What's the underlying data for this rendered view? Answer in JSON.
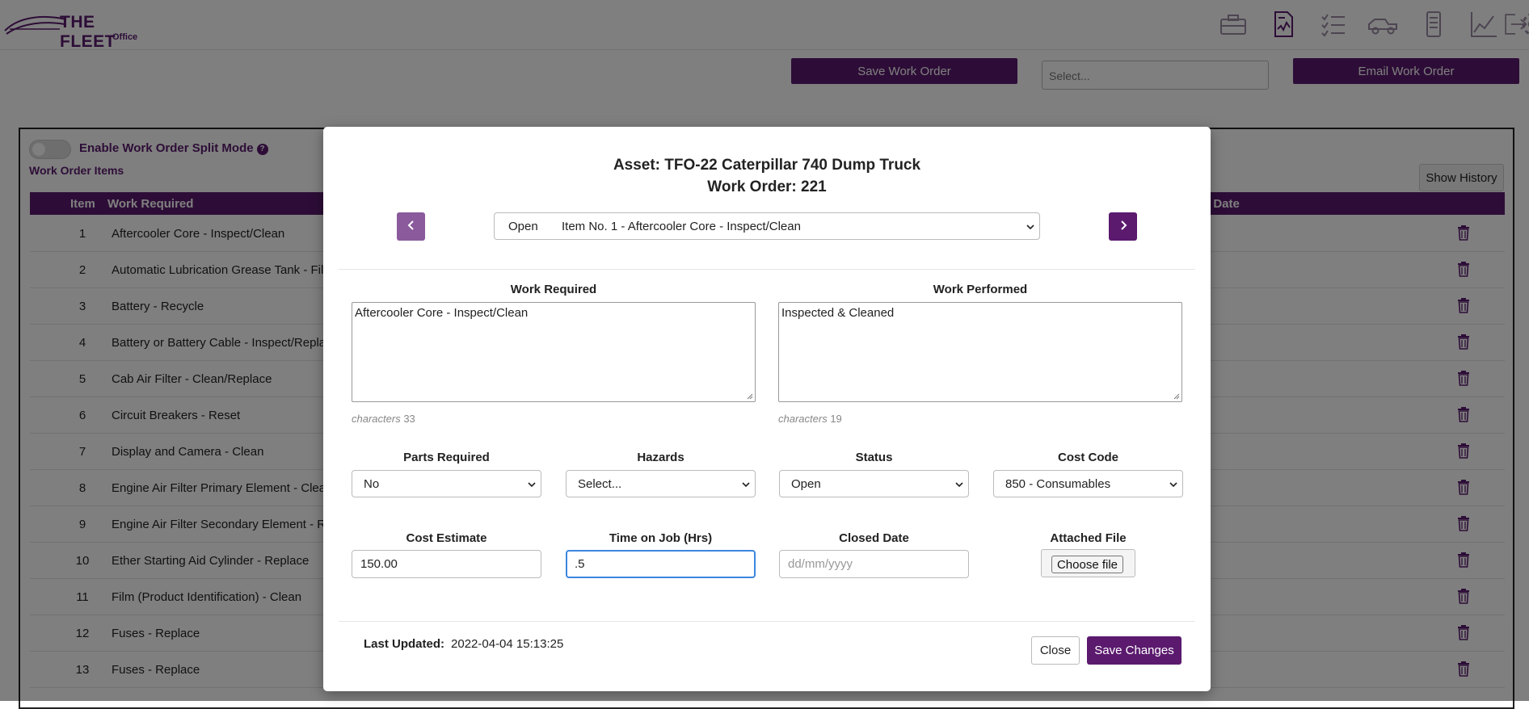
{
  "app": {
    "logo_line1": "THE FLEET",
    "logo_line2": "Office",
    "accent": "#5b1a6e",
    "nav_icons": [
      "toolbox-icon",
      "report-icon",
      "checklist-icon",
      "truck-icon",
      "device-icon",
      "chart-icon",
      "gear-icon",
      "logout-icon"
    ]
  },
  "toolbar": {
    "save_work_order": "Save Work Order",
    "select_placeholder": "Select...",
    "email_work_order": "Email Work Order"
  },
  "work_order_page": {
    "split_mode_label": "Enable Work Order Split Mode",
    "split_mode_enabled": false,
    "items_label": "Work Order Items",
    "show_history": "Show History",
    "columns": {
      "item": "Item",
      "work_required": "Work Required",
      "closed_date_partial": "d Date"
    },
    "rows": [
      {
        "item": "1",
        "work_required": "Aftercooler Core - Inspect/Clean"
      },
      {
        "item": "2",
        "work_required": "Automatic Lubrication Grease Tank - Fill"
      },
      {
        "item": "3",
        "work_required": "Battery - Recycle"
      },
      {
        "item": "4",
        "work_required": "Battery or Battery Cable - Inspect/Replace"
      },
      {
        "item": "5",
        "work_required": "Cab Air Filter - Clean/Replace"
      },
      {
        "item": "6",
        "work_required": "Circuit Breakers - Reset"
      },
      {
        "item": "7",
        "work_required": "Display and Camera - Clean"
      },
      {
        "item": "8",
        "work_required": "Engine Air Filter Primary Element - Clean/R"
      },
      {
        "item": "9",
        "work_required": "Engine Air Filter Secondary Element - Rep"
      },
      {
        "item": "10",
        "work_required": "Ether Starting Aid Cylinder - Replace"
      },
      {
        "item": "11",
        "work_required": "Film (Product Identification) - Clean"
      },
      {
        "item": "12",
        "work_required": "Fuses - Replace"
      },
      {
        "item": "13",
        "work_required": "Fuses - Replace"
      }
    ]
  },
  "modal": {
    "asset_line": "Asset: TFO-22 Caterpillar 740 Dump Truck",
    "work_order_line": "Work Order: 221",
    "item_select": {
      "status": "Open",
      "item": "Item No. 1 - Aftercooler Core - Inspect/Clean"
    },
    "work_required": {
      "label": "Work Required",
      "value": "Aftercooler Core - Inspect/Clean",
      "char_label": "characters",
      "char_count": "33"
    },
    "work_performed": {
      "label": "Work Performed",
      "value": "Inspected & Cleaned",
      "char_label": "characters",
      "char_count": "19"
    },
    "parts_required": {
      "label": "Parts Required",
      "value": "No"
    },
    "hazards": {
      "label": "Hazards",
      "value": "Select..."
    },
    "status": {
      "label": "Status",
      "value": "Open"
    },
    "cost_code": {
      "label": "Cost Code",
      "value": "850 - Consumables"
    },
    "cost_estimate": {
      "label": "Cost Estimate",
      "value": "150.00"
    },
    "time_on_job": {
      "label": "Time on Job (Hrs)",
      "value": ".5"
    },
    "closed_date": {
      "label": "Closed Date",
      "placeholder": "dd/mm/yyyy"
    },
    "attached_file": {
      "label": "Attached File",
      "button": "Choose file"
    },
    "last_updated_label": "Last Updated:",
    "last_updated_value": "2022-04-04 15:13:25",
    "close": "Close",
    "save_changes": "Save Changes"
  }
}
